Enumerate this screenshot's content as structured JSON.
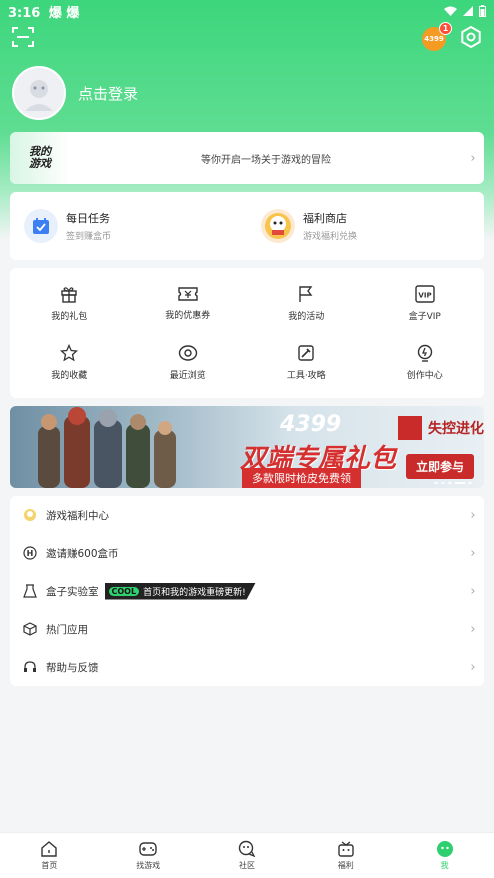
{
  "status_bar": {
    "time": "3:16",
    "indicators": "爆 爆"
  },
  "header": {
    "coin_label": "4399",
    "badge_count": "1",
    "login_text": "点击登录"
  },
  "promo": {
    "logo_line1": "我的",
    "logo_line2": "游戏",
    "text": "等你开启一场关于游戏的冒险"
  },
  "tasks": [
    {
      "title": "每日任务",
      "sub": "签到赚盒币"
    },
    {
      "title": "福利商店",
      "sub": "游戏福利兑换"
    }
  ],
  "grid": [
    {
      "label": "我的礼包",
      "icon": "gift-icon"
    },
    {
      "label": "我的优惠券",
      "icon": "coupon-icon"
    },
    {
      "label": "我的活动",
      "icon": "flag-icon"
    },
    {
      "label": "盒子VIP",
      "icon": "vip-icon"
    },
    {
      "label": "我的收藏",
      "icon": "star-icon"
    },
    {
      "label": "最近浏览",
      "icon": "eye-icon"
    },
    {
      "label": "工具·攻略",
      "icon": "tools-icon"
    },
    {
      "label": "创作中心",
      "icon": "bulb-icon"
    }
  ],
  "banner": {
    "brand_number": "4399",
    "title": "双端专属礼包",
    "subtitle": "多款限时枪皮免费领",
    "game_name": "失控进化",
    "cta": "立即参与"
  },
  "menu": [
    {
      "label": "游戏福利中心",
      "icon": "welfare-icon"
    },
    {
      "label": "邀请赚600盒币",
      "icon": "invite-icon"
    },
    {
      "label": "盒子实验室",
      "icon": "lab-icon",
      "tag_cool": "COOL",
      "tag_text": "首页和我的游戏重磅更新!"
    },
    {
      "label": "热门应用",
      "icon": "box-icon"
    },
    {
      "label": "帮助与反馈",
      "icon": "headset-icon"
    }
  ],
  "tabbar": [
    {
      "label": "首页",
      "icon": "home-icon"
    },
    {
      "label": "找游戏",
      "icon": "gamepad-icon"
    },
    {
      "label": "社区",
      "icon": "community-icon"
    },
    {
      "label": "福利",
      "icon": "welfare-tab-icon"
    },
    {
      "label": "我",
      "icon": "me-icon",
      "active": true
    }
  ],
  "colors": {
    "accent": "#2fcf70",
    "banner_red": "#d52f2f"
  }
}
